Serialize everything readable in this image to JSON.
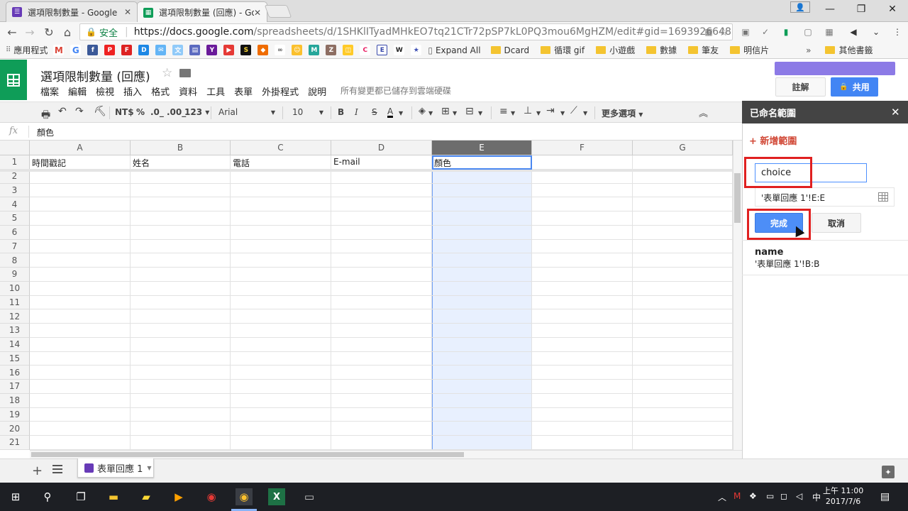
{
  "browser": {
    "tabs": [
      {
        "title": "選項限制數量 - Google ",
        "active": false
      },
      {
        "title": "選項限制數量 (回應) - Go",
        "active": true
      }
    ],
    "secure_label": "安全",
    "url_host": "https://docs.google.com",
    "url_path": "/spreadsheets/d/1SHKlITyadMHkEO7tq21CTr72pSP7kL0PQ3mou6MgHZM/edit#gid=1693926648",
    "bookmarks": {
      "apps": "應用程式",
      "expand_all": "Expand All",
      "dcard": "Dcard",
      "folders": [
        "循環 gif",
        "小遊戲",
        "數據",
        "筆友",
        "明信片"
      ],
      "more": "»",
      "other": "其他書籤"
    }
  },
  "doc": {
    "title": "選項限制數量 (回應)",
    "menu": [
      "檔案",
      "編輯",
      "檢視",
      "插入",
      "格式",
      "資料",
      "工具",
      "表單",
      "外掛程式",
      "說明"
    ],
    "save_status": "所有變更都已儲存到雲端硬碟",
    "comment_label": "註解",
    "share_label": "共用"
  },
  "toolbar": {
    "currency": "NT$",
    "percent": "%",
    "dec_less": ".0_",
    "dec_more": ".00_",
    "format_123": "123",
    "font": "Arial",
    "size": "10",
    "bold": "B",
    "italic": "I",
    "strike": "S",
    "text_color": "A",
    "more": "更多選項"
  },
  "formula": {
    "fx": "fx",
    "value": "顏色"
  },
  "grid": {
    "columns": [
      "A",
      "B",
      "C",
      "D",
      "E",
      "F",
      "G"
    ],
    "selected_column": "E",
    "rows": [
      "1",
      "2",
      "3",
      "4",
      "5",
      "6",
      "7",
      "8",
      "9",
      "10",
      "11",
      "12",
      "13",
      "14",
      "15",
      "16",
      "17",
      "18",
      "19",
      "20",
      "21"
    ],
    "header_row": [
      "時間戳記",
      "姓名",
      "電話",
      "E-mail",
      "顏色",
      "",
      ""
    ]
  },
  "sheets": {
    "tab_label": "表單回應 1"
  },
  "panel": {
    "title": "已命名範圍",
    "add_range": "+ 新增範圍",
    "name_value": "choice",
    "range_value": "'表單回應 1'!E:E",
    "done_label": "完成",
    "cancel_label": "取消",
    "existing_name": "name",
    "existing_ref": "'表單回應 1'!B:B"
  },
  "taskbar": {
    "ime": "中",
    "time": "上午 11:00",
    "date": "2017/7/6"
  }
}
